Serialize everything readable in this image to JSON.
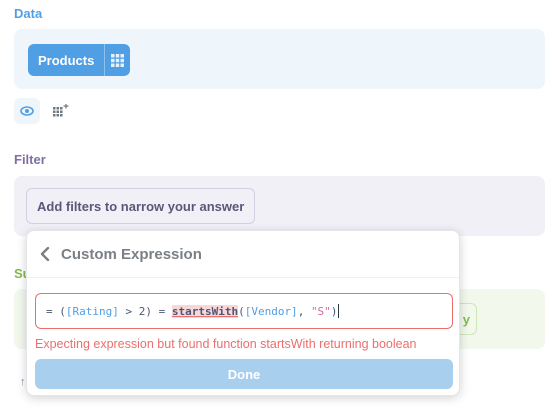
{
  "data_section": {
    "label": "Data",
    "table_pill": {
      "label": "Products",
      "icon": "grid-icon"
    },
    "actions": [
      {
        "name": "preview",
        "icon": "eye-icon"
      },
      {
        "name": "join",
        "icon": "join-plus-icon"
      }
    ]
  },
  "filter_section": {
    "label": "Filter",
    "add_button_label": "Add filters to narrow your answer"
  },
  "summarize_section": {
    "label_visible": "Su",
    "button_visible": "y"
  },
  "popover": {
    "title": "Custom Expression",
    "back_icon": "chevron-left-icon",
    "expression": {
      "prefix": "= (",
      "field1": "[Rating]",
      "mid": " > 2) = ",
      "function": "startsWith",
      "open_paren": "(",
      "field2": "[Vendor]",
      "comma": ", ",
      "string": "\"S\"",
      "close_paren": ")"
    },
    "error": "Expecting expression but found function startsWith returning boolean",
    "done_label": "Done"
  },
  "colors": {
    "data_accent": "#509ee3",
    "filter_accent": "#7f6fa4",
    "summarize_accent": "#84bb4c",
    "error": "#ed6e6e",
    "done_disabled": "#a9cfef"
  }
}
